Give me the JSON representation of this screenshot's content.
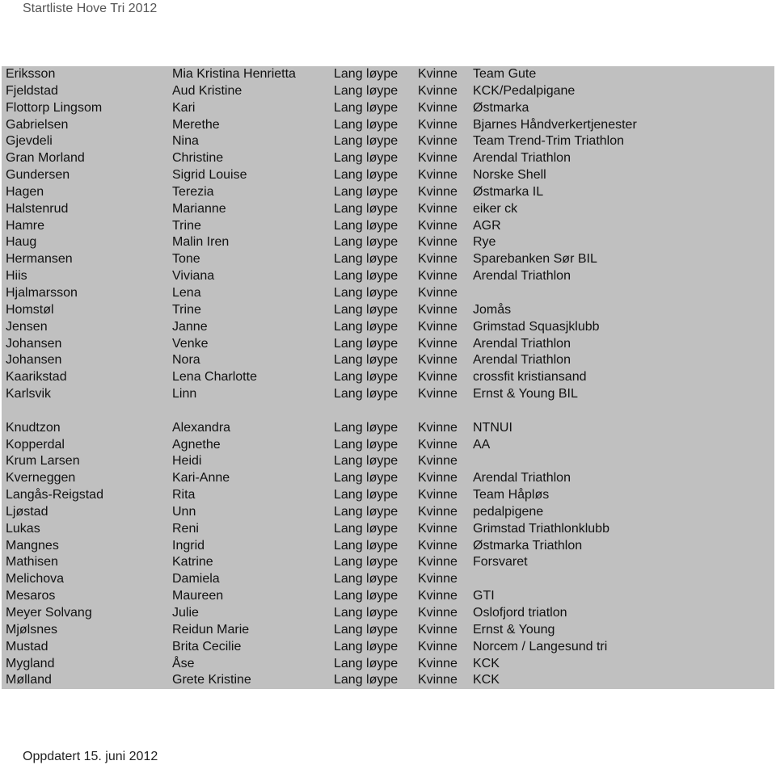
{
  "header": {
    "title": "Startliste Hove Tri 2012"
  },
  "rows": [
    [
      "Eriksson",
      "Mia Kristina Henrietta",
      "Lang løype",
      "Kvinne",
      "Team Gute"
    ],
    [
      "Fjeldstad",
      "Aud Kristine",
      "Lang løype",
      "Kvinne",
      "KCK/Pedalpigane"
    ],
    [
      "Flottorp Lingsom",
      "Kari",
      "Lang løype",
      "Kvinne",
      "Østmarka"
    ],
    [
      "Gabrielsen",
      "Merethe",
      "Lang løype",
      "Kvinne",
      "Bjarnes Håndverkertjenester"
    ],
    [
      "Gjevdeli",
      "Nina",
      "Lang løype",
      "Kvinne",
      "Team Trend-Trim Triathlon"
    ],
    [
      "Gran Morland",
      "Christine",
      "Lang løype",
      "Kvinne",
      "Arendal Triathlon"
    ],
    [
      "Gundersen",
      "Sigrid Louise",
      "Lang løype",
      "Kvinne",
      "Norske Shell"
    ],
    [
      "Hagen",
      "Terezia",
      "Lang løype",
      "Kvinne",
      "Østmarka IL"
    ],
    [
      "Halstenrud",
      "Marianne",
      "Lang løype",
      "Kvinne",
      "eiker ck"
    ],
    [
      "Hamre",
      "Trine",
      "Lang løype",
      "Kvinne",
      "AGR"
    ],
    [
      "Haug",
      "Malin Iren",
      "Lang løype",
      "Kvinne",
      "Rye"
    ],
    [
      "Hermansen",
      "Tone",
      "Lang løype",
      "Kvinne",
      "Sparebanken Sør BIL"
    ],
    [
      "Hiis",
      "Viviana",
      "Lang løype",
      "Kvinne",
      "Arendal Triathlon"
    ],
    [
      "Hjalmarsson",
      "Lena",
      "Lang løype",
      "Kvinne",
      ""
    ],
    [
      "Homstøl",
      "Trine",
      "Lang løype",
      "Kvinne",
      "Jomås"
    ],
    [
      "Jensen",
      "Janne",
      "Lang løype",
      "Kvinne",
      "Grimstad Squasjklubb"
    ],
    [
      "Johansen",
      "Venke",
      "Lang løype",
      "Kvinne",
      "Arendal Triathlon"
    ],
    [
      "Johansen",
      "Nora",
      "Lang løype",
      "Kvinne",
      "Arendal Triathlon"
    ],
    [
      "Kaarikstad",
      "Lena Charlotte",
      "Lang løype",
      "Kvinne",
      "crossfit kristiansand"
    ],
    [
      "Karlsvik",
      "Linn",
      "Lang løype",
      "Kvinne",
      "Ernst & Young BIL"
    ],
    [
      "",
      "",
      "",
      "",
      ""
    ],
    [
      "Knudtzon",
      "Alexandra",
      "Lang løype",
      "Kvinne",
      "NTNUI"
    ],
    [
      "Kopperdal",
      "Agnethe",
      "Lang løype",
      "Kvinne",
      "AA"
    ],
    [
      "Krum Larsen",
      "Heidi",
      "Lang løype",
      "Kvinne",
      ""
    ],
    [
      "Kverneggen",
      "Kari-Anne",
      "Lang løype",
      "Kvinne",
      "Arendal Triathlon"
    ],
    [
      "Langås-Reigstad",
      "Rita",
      "Lang løype",
      "Kvinne",
      "Team Håpløs"
    ],
    [
      "Ljøstad",
      "Unn",
      "Lang løype",
      "Kvinne",
      "pedalpigene"
    ],
    [
      "Lukas",
      "Reni",
      "Lang løype",
      "Kvinne",
      "Grimstad Triathlonklubb"
    ],
    [
      "Mangnes",
      "Ingrid",
      "Lang løype",
      "Kvinne",
      "Østmarka Triathlon"
    ],
    [
      "Mathisen",
      "Katrine",
      "Lang løype",
      "Kvinne",
      "Forsvaret"
    ],
    [
      "Melichova",
      "Damiela",
      "Lang løype",
      "Kvinne",
      ""
    ],
    [
      "Mesaros",
      "Maureen",
      "Lang løype",
      "Kvinne",
      "GTI"
    ],
    [
      "Meyer Solvang",
      "Julie",
      "Lang løype",
      "Kvinne",
      "Oslofjord triatlon"
    ],
    [
      "Mjølsnes",
      "Reidun Marie",
      "Lang løype",
      "Kvinne",
      "Ernst & Young"
    ],
    [
      "Mustad",
      "Brita Cecilie",
      "Lang løype",
      "Kvinne",
      "Norcem / Langesund tri"
    ],
    [
      "Mygland",
      "Åse",
      "Lang løype",
      "Kvinne",
      "KCK"
    ],
    [
      "Mølland",
      "Grete Kristine",
      "Lang løype",
      "Kvinne",
      "KCK"
    ]
  ],
  "footer": {
    "updated": "Oppdatert 15. juni 2012"
  },
  "colors": {
    "table_bg": "#c0c0c0"
  }
}
